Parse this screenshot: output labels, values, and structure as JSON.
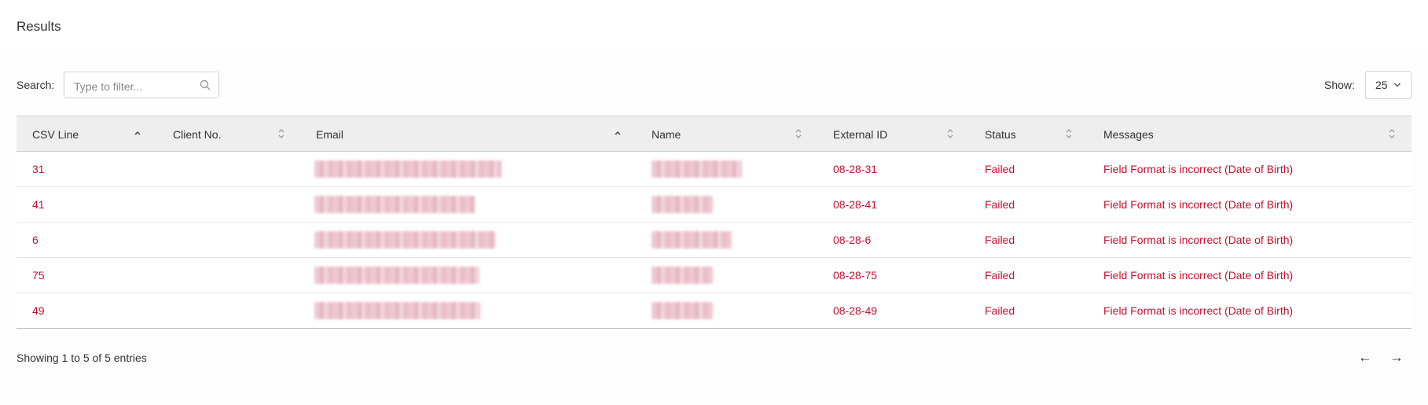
{
  "header": {
    "title": "Results"
  },
  "toolbar": {
    "search_label": "Search:",
    "search_placeholder": "Type to filter...",
    "search_value": "",
    "show_label": "Show:",
    "show_value": "25"
  },
  "table": {
    "columns": [
      "CSV Line",
      "Client No.",
      "Email",
      "Name",
      "External ID",
      "Status",
      "Messages"
    ],
    "sort_states": [
      "asc",
      "none",
      "asc",
      "none",
      "none",
      "none",
      "none"
    ],
    "rows": [
      {
        "csv_line": "31",
        "client_no": "",
        "external_id": "08-28-31",
        "status": "Failed",
        "message": "Field Format is incorrect (Date of Birth)"
      },
      {
        "csv_line": "41",
        "client_no": "",
        "external_id": "08-28-41",
        "status": "Failed",
        "message": "Field Format is incorrect (Date of Birth)"
      },
      {
        "csv_line": "6",
        "client_no": "",
        "external_id": "08-28-6",
        "status": "Failed",
        "message": "Field Format is incorrect (Date of Birth)"
      },
      {
        "csv_line": "75",
        "client_no": "",
        "external_id": "08-28-75",
        "status": "Failed",
        "message": "Field Format is incorrect (Date of Birth)"
      },
      {
        "csv_line": "49",
        "client_no": "",
        "external_id": "08-28-49",
        "status": "Failed",
        "message": "Field Format is incorrect (Date of Birth)"
      }
    ]
  },
  "footer": {
    "entries_text": "Showing 1 to 5 of 5 entries",
    "prev_label": "←",
    "next_label": "→"
  },
  "colors": {
    "error": "#c8102e",
    "header_bg": "#eeeeee"
  },
  "icons": {
    "search": "search-icon",
    "select": "chevron-down-icon",
    "sort_asc": "sort-asc-icon",
    "sort_both": "sort-icon"
  }
}
